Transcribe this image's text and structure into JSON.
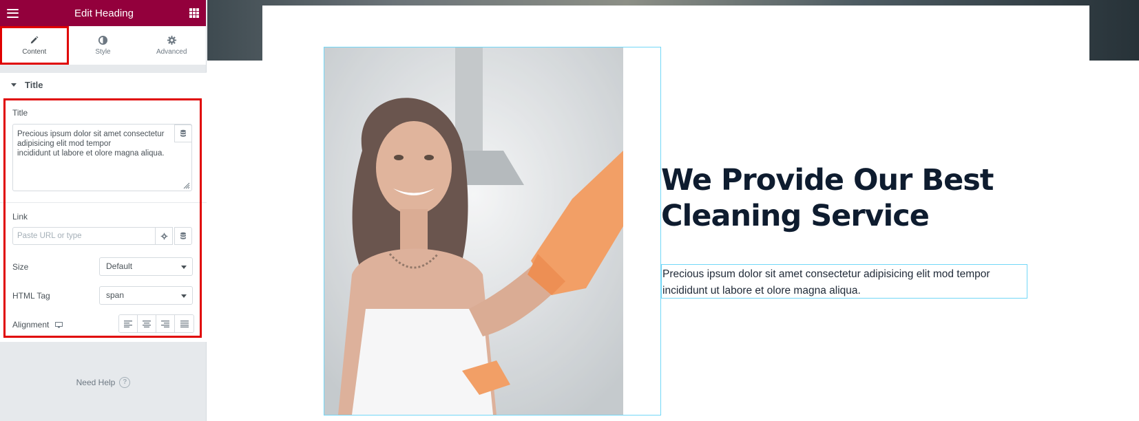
{
  "panel": {
    "title": "Edit Heading",
    "menu_icon": "hamburger-menu-icon",
    "apps_icon": "widgets-grid-icon",
    "accent_color": "#93003c",
    "tabs": [
      {
        "label": "Content",
        "icon": "pencil-icon",
        "active": true
      },
      {
        "label": "Style",
        "icon": "half-circle-icon",
        "active": false
      },
      {
        "label": "Advanced",
        "icon": "gear-icon",
        "active": false
      }
    ],
    "section_title": "Title",
    "title_control": {
      "label": "Title",
      "value": "Precious ipsum dolor sit amet consectetur\nadipisicing elit mod tempor\nincididunt ut labore et olore magna aliqua."
    },
    "link_control": {
      "label": "Link",
      "placeholder": "Paste URL or type"
    },
    "size_control": {
      "label": "Size",
      "value": "Default"
    },
    "html_tag_control": {
      "label": "HTML Tag",
      "value": "span"
    },
    "alignment_control": {
      "label": "Alignment",
      "options": [
        "left",
        "center",
        "right",
        "justify"
      ]
    },
    "need_help": "Need Help",
    "help_symbol": "?",
    "highlight_color": "#e00000"
  },
  "preview": {
    "heading_line1": "We Provide Our Best",
    "heading_line2": "Cleaning Service",
    "paragraph_line1": "Precious ipsum dolor sit amet consectetur adipisicing elit mod tempor",
    "paragraph_line2": "incididunt ut labore et olore magna aliqua.",
    "heading_color": "#0e1c2f",
    "selection_color": "#71d7f7"
  }
}
